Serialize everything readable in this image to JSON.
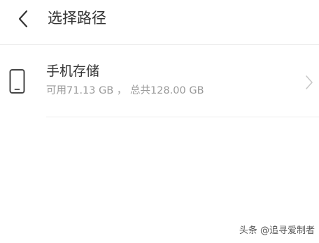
{
  "header": {
    "title": "选择路径",
    "back_icon": "chevron-left-icon"
  },
  "storage": {
    "icon": "smartphone-icon",
    "title": "手机存储",
    "available_label": "可用71.13 GB ， 总共128.00 GB",
    "chevron_icon": "chevron-right-icon"
  },
  "watermark": {
    "text": "头条 @追寻爱制者"
  },
  "colors": {
    "title": "#333333",
    "subtitle": "#9a9a9a",
    "divider": "#ececec",
    "chevron": "#c8c8c8"
  }
}
